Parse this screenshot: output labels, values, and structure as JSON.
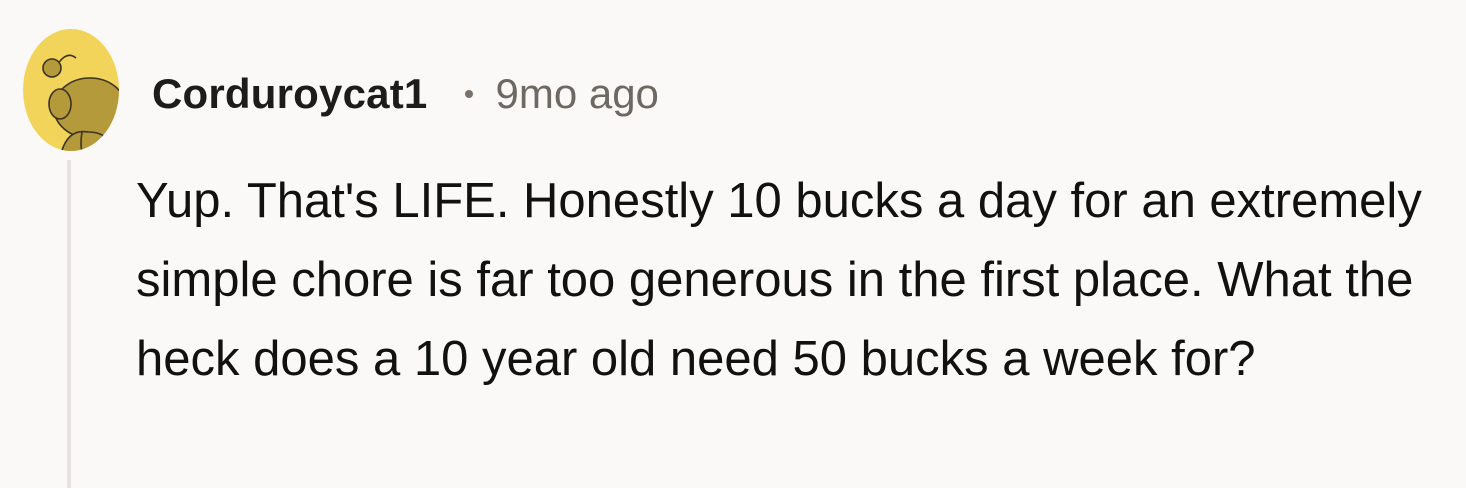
{
  "comment": {
    "avatar_icon": "snoo-avatar-icon",
    "username": "Corduroycat1",
    "separator": "•",
    "timestamp": "9mo ago",
    "body": "Yup. That's LIFE. Honestly 10 bucks a day for an extremely simple chore is far too generous in the first place. What the heck does a 10 year old need 50 bucks a week for?"
  },
  "colors": {
    "background": "#faf9f7",
    "avatar_bg": "#f2d45a",
    "avatar_figure": "#b59a3c",
    "thread_line": "#e7e2dd",
    "username": "#1c1c1c",
    "timestamp": "#6e6862",
    "body_text": "#111111"
  }
}
